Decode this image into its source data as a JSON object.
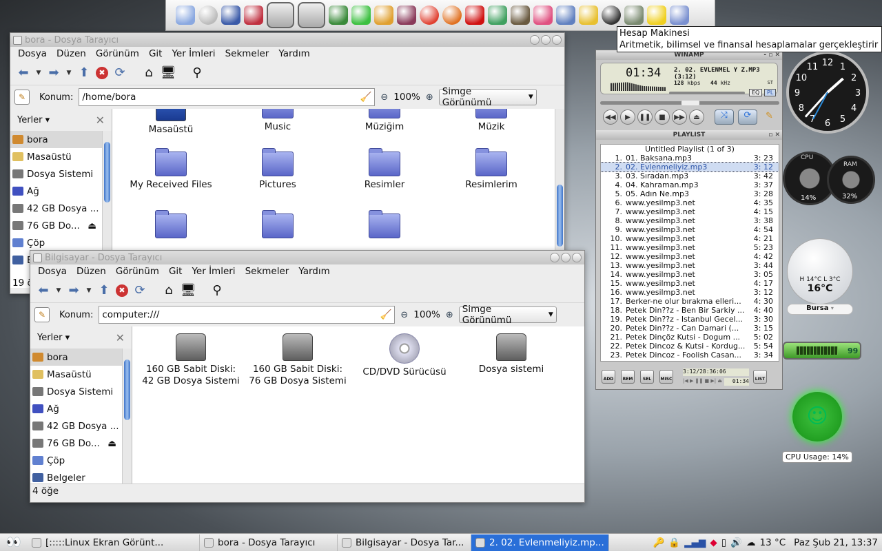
{
  "dock": {
    "items": [
      {
        "name": "gnome-foot-icon",
        "color": "#8aa8e0"
      },
      {
        "name": "power-icon",
        "color": "#bbbbbb"
      },
      {
        "name": "laptop-icon",
        "color": "#3a5aa8"
      },
      {
        "name": "book-icon",
        "color": "#c03040"
      },
      {
        "name": "hard-drive-icon",
        "color": "#aaaaaa"
      },
      {
        "name": "hard-drive-icon",
        "color": "#aaaaaa"
      },
      {
        "name": "system-monitor-icon",
        "color": "#3a8a3a"
      },
      {
        "name": "gem-icon",
        "color": "#3cc040"
      },
      {
        "name": "broom-icon",
        "color": "#e0a030"
      },
      {
        "name": "package-icon",
        "color": "#8a3a5a"
      },
      {
        "name": "chrome-icon",
        "color": "#e04030"
      },
      {
        "name": "firefox-icon",
        "color": "#e07020"
      },
      {
        "name": "opera-icon",
        "color": "#d01010"
      },
      {
        "name": "messenger-icon",
        "color": "#40a060"
      },
      {
        "name": "gimp-icon",
        "color": "#6a5a40"
      },
      {
        "name": "picasa-icon",
        "color": "#e05080"
      },
      {
        "name": "speaker-icon",
        "color": "#6080c0"
      },
      {
        "name": "amarok-icon",
        "color": "#e8c030"
      },
      {
        "name": "music-player-icon",
        "color": "#333333"
      },
      {
        "name": "calculator-icon",
        "color": "#7a8a70"
      },
      {
        "name": "notes-icon",
        "color": "#f0d020"
      },
      {
        "name": "trash-icon",
        "color": "#7a90d0"
      }
    ]
  },
  "tooltip": {
    "title": "Hesap Makinesi",
    "desc": "Aritmetik, bilimsel ve finansal hesaplamalar gerçekleştirir"
  },
  "win1": {
    "title": "bora - Dosya Tarayıcı",
    "location_label": "Konum:",
    "location": "/home/bora",
    "zoom": "100%",
    "view": "Simge Görünümü",
    "status": "19 ö",
    "files": [
      {
        "label": "Masaüstü",
        "icon": "desktop-icon"
      },
      {
        "label": "Music",
        "icon": "folder-icon"
      },
      {
        "label": "Müziğim",
        "icon": "folder-icon"
      },
      {
        "label": "Müzik",
        "icon": "folder-icon"
      },
      {
        "label": "My Received Files",
        "icon": "folder-icon"
      },
      {
        "label": "Pictures",
        "icon": "folder-icon"
      },
      {
        "label": "Resimler",
        "icon": "folder-icon"
      },
      {
        "label": "Resimlerim",
        "icon": "folder-icon"
      }
    ]
  },
  "win2": {
    "title": "Bilgisayar - Dosya Tarayıcı",
    "location_label": "Konum:",
    "location": "computer:///",
    "zoom": "100%",
    "view": "Simge Görünümü",
    "status": "4 öğe",
    "files": [
      {
        "label": "160 GB Sabit Diski: 42 GB Dosya Sistemi",
        "icon": "hard-drive-icon"
      },
      {
        "label": "160 GB Sabit Diski: 76 GB Dosya Sistemi",
        "icon": "hard-drive-icon"
      },
      {
        "label": "CD/DVD Sürücüsü",
        "icon": "cd-icon"
      },
      {
        "label": "Dosya sistemi",
        "icon": "hard-drive-icon"
      }
    ]
  },
  "menu": [
    "Dosya",
    "Düzen",
    "Görünüm",
    "Git",
    "Yer İmleri",
    "Sekmeler",
    "Yardım"
  ],
  "sidebar": {
    "header": "Yerler",
    "items": [
      {
        "label": "bora",
        "color": "#d08a30"
      },
      {
        "label": "Masaüstü",
        "color": "#e0c060"
      },
      {
        "label": "Dosya Sistemi",
        "color": "#777777"
      },
      {
        "label": "Ağ",
        "color": "#4050c0"
      },
      {
        "label": "42 GB Dosya ...",
        "color": "#777777"
      },
      {
        "label": "76 GB Do...",
        "color": "#777777"
      },
      {
        "label": "Çöp",
        "color": "#6080d0"
      },
      {
        "label": "Belgeler",
        "color": "#4060a0"
      }
    ]
  },
  "winamp": {
    "title": "WINAMP",
    "time": "01:34",
    "track": "2. 02. EVLENMEL Y Z.MP3 (3:12)",
    "kbps": "128",
    "kbps_unit": "kbps",
    "khz": "44",
    "khz_unit": "kHz",
    "stereo": "ST",
    "eq": "EQ",
    "pl": "PL",
    "playlist_title": "PLAYLIST",
    "playlist_name": "Untitled Playlist (1 of 3)",
    "tracks": [
      [
        "1.",
        "01. Baksana.mp3",
        "3: 23"
      ],
      [
        "2.",
        "02. Evlenmeliyiz.mp3",
        "3: 12"
      ],
      [
        "3.",
        "03. Sıradan.mp3",
        "3: 42"
      ],
      [
        "4.",
        "04. Kahraman.mp3",
        "3: 37"
      ],
      [
        "5.",
        "05. Adın Ne.mp3",
        "3: 28"
      ],
      [
        "6.",
        "www.yesilmp3.net",
        "4: 35"
      ],
      [
        "7.",
        "www.yesilmp3.net",
        "4: 15"
      ],
      [
        "8.",
        "www.yesilmp3.net",
        "3: 38"
      ],
      [
        "9.",
        "www.yesilmp3.net",
        "4: 54"
      ],
      [
        "10.",
        "www.yesilmp3.net",
        "4: 21"
      ],
      [
        "11.",
        "www.yesilmp3.net",
        "5: 23"
      ],
      [
        "12.",
        "www.yesilmp3.net",
        "4: 42"
      ],
      [
        "13.",
        "www.yesilmp3.net",
        "3: 44"
      ],
      [
        "14.",
        "www.yesilmp3.net",
        "3: 05"
      ],
      [
        "15.",
        "www.yesilmp3.net",
        "4: 17"
      ],
      [
        "16.",
        "www.yesilmp3.net",
        "3: 12"
      ],
      [
        "17.",
        "Berker-ne olur bırakma elleri...",
        "4: 30"
      ],
      [
        "18.",
        "Petek Din??z - Ben Bir Sarkiy ...",
        "4: 40"
      ],
      [
        "19.",
        "Petek Din??z - Istanbul Gecel...",
        "3: 30"
      ],
      [
        "20.",
        "Petek Din??z - Can Damari  (...",
        "3: 15"
      ],
      [
        "21.",
        "Petek Dinçöz Kutsi - Dogum ...",
        "5: 02"
      ],
      [
        "22.",
        "Petek Dincoz & Kutsi - Kordug...",
        "5: 54"
      ],
      [
        "23.",
        "Petek Dincoz - Foolish Casan...",
        "3: 34"
      ]
    ],
    "current_index": 1,
    "pl_buttons": [
      "ADD",
      "REM",
      "SEL",
      "MISC"
    ],
    "list_button": "LIST",
    "total": "3:12/28:36:06",
    "mini_time": "01:34"
  },
  "gadgets": {
    "cpu_label": "CPU",
    "cpu": "14%",
    "ram_label": "RAM",
    "ram": "32%",
    "weather_hl": "H 14°C L 3°C",
    "weather_temp": "16°C",
    "city": "Bursa",
    "battery": "99",
    "cpu_usage": "CPU Usage: 14%"
  },
  "clock": {
    "hour": 1,
    "minute": 37
  },
  "taskbar": {
    "tasks": [
      {
        "label": "[:::::Linux Ekran Görünt...",
        "active": false
      },
      {
        "label": "bora - Dosya Tarayıcı",
        "active": false
      },
      {
        "label": "Bilgisayar - Dosya Tar...",
        "active": false
      },
      {
        "label": "2. 02. Evlenmeliyiz.mp...",
        "active": true
      }
    ],
    "weather": "13 °C",
    "datetime": "Paz Şub 21, 13:37"
  },
  "colors": {
    "accent": "#2a6fd8",
    "selection": "#cfdcf2"
  }
}
